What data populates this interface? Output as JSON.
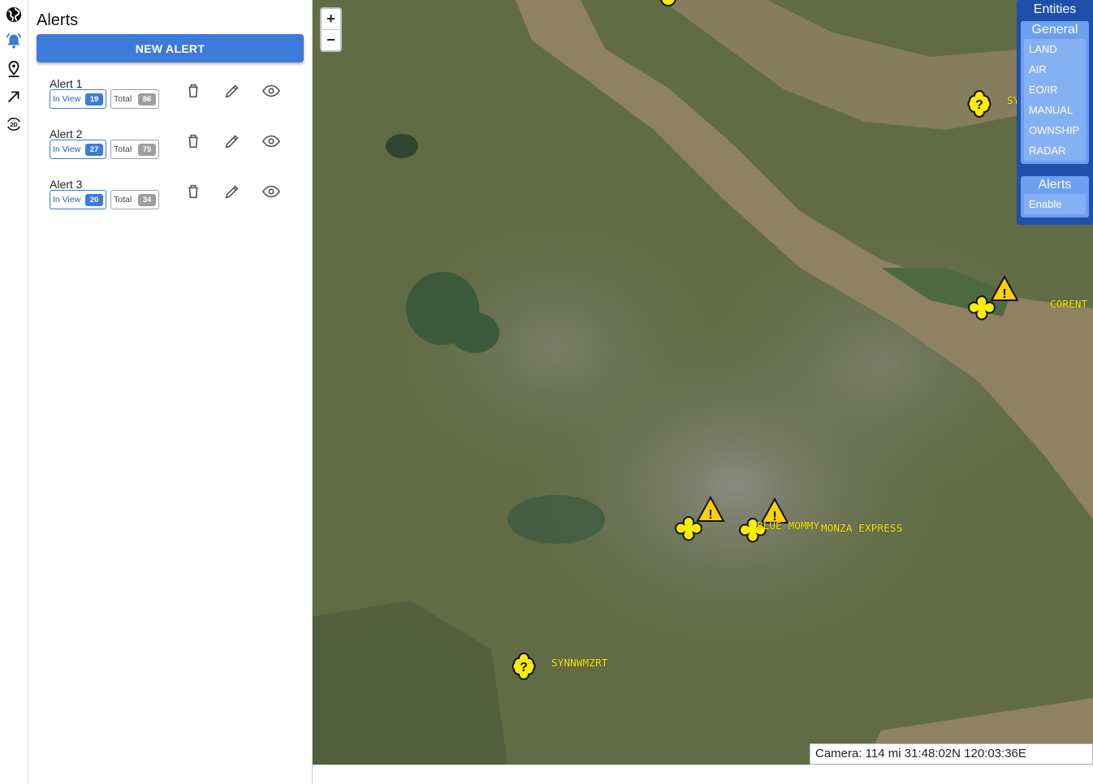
{
  "sidebar": {
    "icons": [
      "globe-icon",
      "alarm-bell-icon",
      "map-pin-icon",
      "arrow-up-right-icon",
      "2d-toggle-icon"
    ],
    "toggle_2d_label": "2D"
  },
  "panel": {
    "title": "Alerts",
    "new_alert_label": "NEW ALERT",
    "alerts": [
      {
        "name": "Alert 1",
        "in_view_label": "In View",
        "in_view": "19",
        "total_label": "Total",
        "total": "86"
      },
      {
        "name": "Alert 2",
        "in_view_label": "In View",
        "in_view": "27",
        "total_label": "Total",
        "total": "75"
      },
      {
        "name": "Alert 3",
        "in_view_label": "In View",
        "in_view": "20",
        "total_label": "Total",
        "total": "34"
      }
    ]
  },
  "map": {
    "zoom_in": "+",
    "zoom_out": "−",
    "labels": {
      "top_right": "SY",
      "corent": "CORENT",
      "blue_mommy": "BLUE MOMMY",
      "monza": "MONZA EXPRESS",
      "synn": "SYNNWMZRT"
    },
    "camera": "Camera: 114 mi 31:48:02N 120:03:36E"
  },
  "entities": {
    "title": "Entities",
    "general_title": "General",
    "general_items": [
      "LAND",
      "AIR",
      "EO/IR",
      "MANUAL",
      "OWNSHIP",
      "RADAR"
    ],
    "alerts_title": "Alerts",
    "alerts_items": [
      "Enable"
    ]
  },
  "colors": {
    "accent": "#3d7bd9",
    "entities_bg": "#1f4fa8",
    "marker": "#ffee00"
  }
}
